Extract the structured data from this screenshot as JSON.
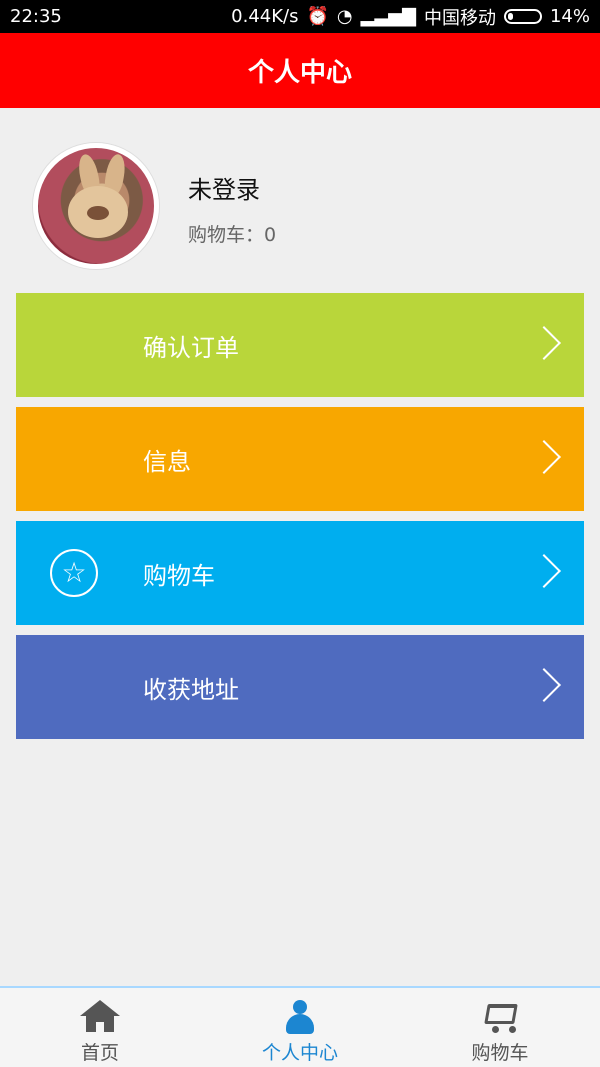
{
  "status_bar": {
    "time": "22:35",
    "network_speed": "0.44K/s",
    "carrier": "中国移动",
    "battery": "14%"
  },
  "header": {
    "title": "个人中心"
  },
  "profile": {
    "user_name": "未登录",
    "cart_label": "购物车：0"
  },
  "menu": {
    "items": [
      {
        "label": "确认订单",
        "color": "#b9d63a"
      },
      {
        "label": "信息",
        "color": "#f8a700"
      },
      {
        "label": "购物车",
        "color": "#00aeef",
        "icon": "star-icon"
      },
      {
        "label": "收获地址",
        "color": "#4f6bbf"
      }
    ]
  },
  "tabbar": {
    "tabs": [
      {
        "label": "首页",
        "icon": "home-icon"
      },
      {
        "label": "个人中心",
        "icon": "person-icon",
        "active": true
      },
      {
        "label": "购物车",
        "icon": "cart-icon"
      }
    ]
  },
  "theme": {
    "header_red": "#ff0000",
    "active_blue": "#1c86d1"
  }
}
